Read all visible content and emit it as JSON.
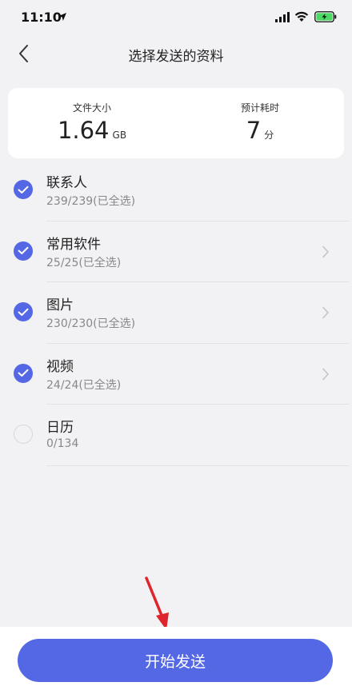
{
  "status_bar": {
    "time": "11:10"
  },
  "nav": {
    "title": "选择发送的资料"
  },
  "summary": {
    "size_label": "文件大小",
    "size_value": "1.64",
    "size_unit": "GB",
    "time_label": "预计耗时",
    "time_value": "7",
    "time_unit": "分"
  },
  "items": [
    {
      "title": "联系人",
      "sub": "239/239(已全选)",
      "checked": true,
      "chevron": false
    },
    {
      "title": "常用软件",
      "sub": "25/25(已全选)",
      "checked": true,
      "chevron": true
    },
    {
      "title": "图片",
      "sub": "230/230(已全选)",
      "checked": true,
      "chevron": true
    },
    {
      "title": "视频",
      "sub": "24/24(已全选)",
      "checked": true,
      "chevron": true
    },
    {
      "title": "日历",
      "sub": "0/134",
      "checked": false,
      "chevron": false
    }
  ],
  "footer": {
    "start_label": "开始发送"
  },
  "colors": {
    "accent": "#5468e6",
    "background": "#f2f2f4",
    "annotation_arrow": "#e0242b"
  },
  "icons": {
    "status": [
      "location-arrow-icon",
      "signal-icon",
      "wifi-icon",
      "battery-icon"
    ],
    "nav": "back-chevron-icon",
    "row_check": "checkmark-icon",
    "row_more": "chevron-right-icon"
  }
}
